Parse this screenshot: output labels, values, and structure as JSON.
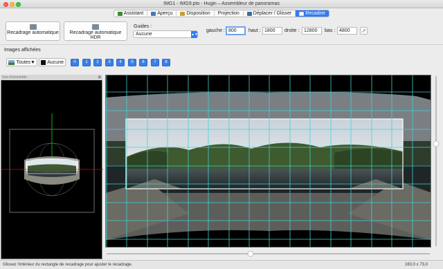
{
  "window": {
    "title": "IMG1 - IMG9.pto - Hugin – Assembleur de panoramas"
  },
  "tabs": [
    {
      "label": "Assistant",
      "icon": "wand-icon",
      "color": "#3a8a2e"
    },
    {
      "label": "Aperçu",
      "icon": "image-preview-icon",
      "color": "#4a78b8"
    },
    {
      "label": "Disposition",
      "icon": "layout-icon",
      "color": "#c9a227"
    },
    {
      "label": "Projection",
      "icon": "",
      "color": ""
    },
    {
      "label": "Déplacer / Glisser",
      "icon": "move-icon",
      "color": "#3a6c9a"
    },
    {
      "label": "Recadrer",
      "icon": "crop-icon",
      "color": "#ffffff"
    }
  ],
  "toolbar": {
    "autocrop_label": "Recadrage automatique",
    "autocrop_hdr_label": "Recadrage automatique HDR",
    "guides_label": "Guides :",
    "guides_value": "Aucune",
    "left_label": "gauche :",
    "left_value": "800",
    "top_label": "haut :",
    "top_value": "1800",
    "right_label": "droite :",
    "right_value": "12800",
    "bottom_label": "bas :",
    "bottom_value": "4800"
  },
  "images": {
    "section_label": "Images affichées",
    "all_label": "Toutes▼",
    "none_label": "Aucune",
    "numbers": [
      "0",
      "1",
      "2",
      "3",
      "4",
      "5",
      "6",
      "7",
      "8"
    ]
  },
  "overview": {
    "title": "Vue d'ensemble",
    "pin": "⊞"
  },
  "status": {
    "message": "Glissez l'intérieur du rectangle de recadrage pour ajuster le recadrage.",
    "coords": "160,0 x 73,0"
  },
  "colors": {
    "accent": "#2f7cf6",
    "grid": "#3fd4d4",
    "number_buttons": "#3a7fe8"
  }
}
